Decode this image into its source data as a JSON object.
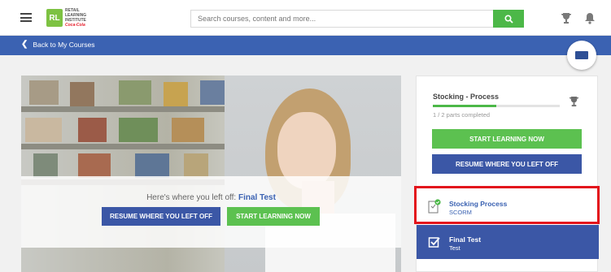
{
  "header": {
    "logo": {
      "line1": "RETAIL",
      "line2": "LEARNING",
      "line3": "INSTITUTE",
      "brand": "Coca-Cola"
    },
    "search": {
      "placeholder": "Search courses, content and more..."
    }
  },
  "nav": {
    "back_label": "Back to My Courses"
  },
  "hero": {
    "left_off_prefix": "Here's where you left off:",
    "left_off_item": "Final Test",
    "resume_label": "RESUME WHERE YOU LEFT OFF",
    "start_label": "START LEARNING NOW"
  },
  "course_panel": {
    "title": "Stocking - Process",
    "progress_text": "1 / 2 parts completed",
    "progress_fraction": 0.5,
    "start_label": "START LEARNING NOW",
    "resume_label": "RESUME WHERE YOU LEFT OFF",
    "items": [
      {
        "title": "Stocking Process",
        "subtitle": "SCORM",
        "icon": "scorm-file-icon",
        "state": "completed"
      },
      {
        "title": "Final Test",
        "subtitle": "Test",
        "icon": "checkbox-icon",
        "state": "active"
      }
    ]
  },
  "colors": {
    "nav_blue": "#3b62b2",
    "button_blue": "#3b57a6",
    "button_green": "#5cc150",
    "highlight_red": "#e3141c"
  }
}
